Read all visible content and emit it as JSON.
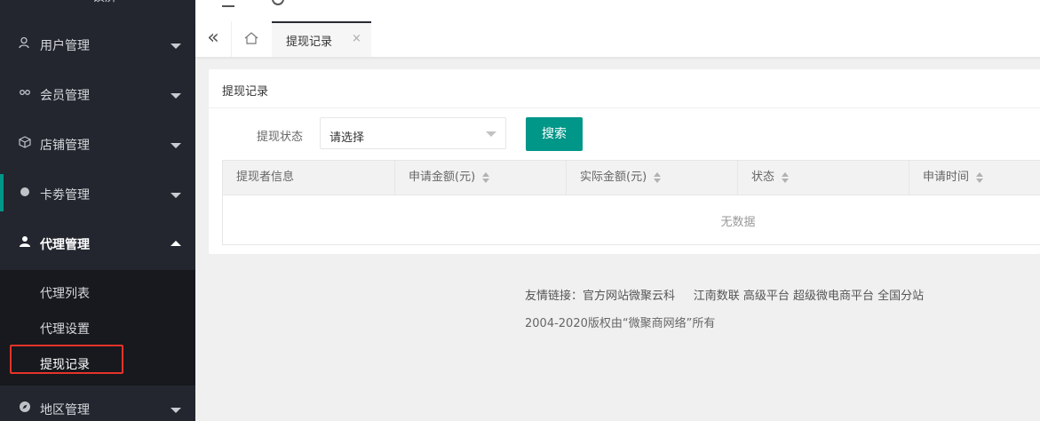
{
  "sidebar": {
    "top_label": "锁屏",
    "menus": [
      {
        "label": "用户管理",
        "icon": "user-icon"
      },
      {
        "label": "会员管理",
        "icon": "link-icon"
      },
      {
        "label": "店铺管理",
        "icon": "box-icon"
      },
      {
        "label": "卡劵管理",
        "icon": "circle-icon"
      },
      {
        "label": "代理管理",
        "icon": "person-icon"
      },
      {
        "label": "地区管理",
        "icon": "compass-icon"
      }
    ],
    "submenu": [
      {
        "label": "代理列表"
      },
      {
        "label": "代理设置"
      },
      {
        "label": "提现记录"
      }
    ],
    "accent_color": "#009688"
  },
  "tabs": {
    "active_label": "提现记录",
    "close_glyph": "×",
    "collapse_glyph": "«"
  },
  "card": {
    "title": "提现记录",
    "filter_label": "提现状态",
    "select_value": "请选择",
    "search_button": "搜索",
    "columns": [
      "提现者信息",
      "申请金额(元)",
      "实际金额(元)",
      "状态",
      "申请时间"
    ],
    "empty_text": "无数据"
  },
  "footer": {
    "links_prefix": "友情链接：",
    "links": [
      "官方网站微聚云科",
      "江南数联",
      "高级平台",
      "超级微电商平台",
      "全国分站"
    ],
    "copyright": "2004-2020版权由“微聚商网络”所有"
  }
}
